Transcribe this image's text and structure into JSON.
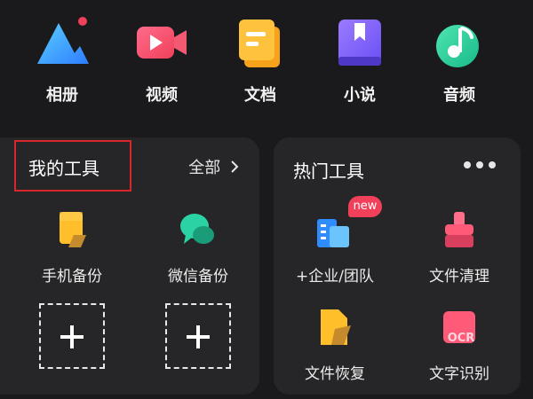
{
  "categories": [
    {
      "label": "相册",
      "icon": "album-icon",
      "has_dot": true
    },
    {
      "label": "视频",
      "icon": "video-icon"
    },
    {
      "label": "文档",
      "icon": "document-icon"
    },
    {
      "label": "小说",
      "icon": "novel-icon"
    },
    {
      "label": "音频",
      "icon": "audio-icon"
    }
  ],
  "my_tools": {
    "title": "我的工具",
    "all_label": "全部",
    "items": [
      {
        "label": "手机备份",
        "icon": "phone-backup-icon"
      },
      {
        "label": "微信备份",
        "icon": "wechat-backup-icon"
      }
    ]
  },
  "hot_tools": {
    "title": "热门工具",
    "items": [
      {
        "label": "+企业/团队",
        "icon": "enterprise-team-icon",
        "badge": "new"
      },
      {
        "label": "文件清理",
        "icon": "file-cleanup-icon"
      },
      {
        "label": "文件恢复",
        "icon": "file-recovery-icon"
      },
      {
        "label": "文字识别",
        "icon": "ocr-icon",
        "icon_text": "OCR"
      }
    ]
  },
  "colors": {
    "background": "#1a1a1c",
    "card": "#262628",
    "highlight_border": "#d8262b",
    "new_badge": "#f0405a"
  }
}
